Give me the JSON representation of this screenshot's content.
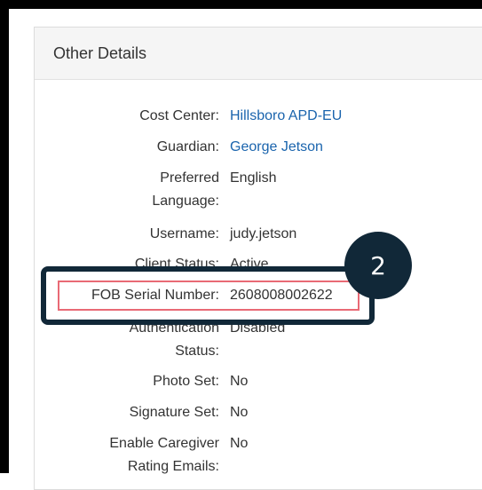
{
  "panel": {
    "title": "Other Details"
  },
  "rows": [
    {
      "label": "Cost Center:",
      "value": "Hillsboro APD-EU",
      "link": true
    },
    {
      "label": "Guardian:",
      "value": "George Jetson",
      "link": true
    },
    {
      "label_line1": "Preferred",
      "label_line2": "Language:",
      "value": "English"
    },
    {
      "label": "Username:",
      "value": "judy.jetson"
    },
    {
      "label": "Client Status:",
      "value": "Active"
    },
    {
      "label": "FOB Serial Number:",
      "value": "2608008002622"
    },
    {
      "label_line1": "Authentication",
      "label_line2": "Status:",
      "value": "Disabled"
    },
    {
      "label": "Photo Set:",
      "value": "No"
    },
    {
      "label": "Signature Set:",
      "value": "No"
    },
    {
      "label_line1": "Enable Caregiver",
      "label_line2": "Rating Emails:",
      "value": "No"
    }
  ],
  "callout": {
    "step_number": "2",
    "highlight_color": "#e96a75",
    "callout_color": "#112838"
  }
}
